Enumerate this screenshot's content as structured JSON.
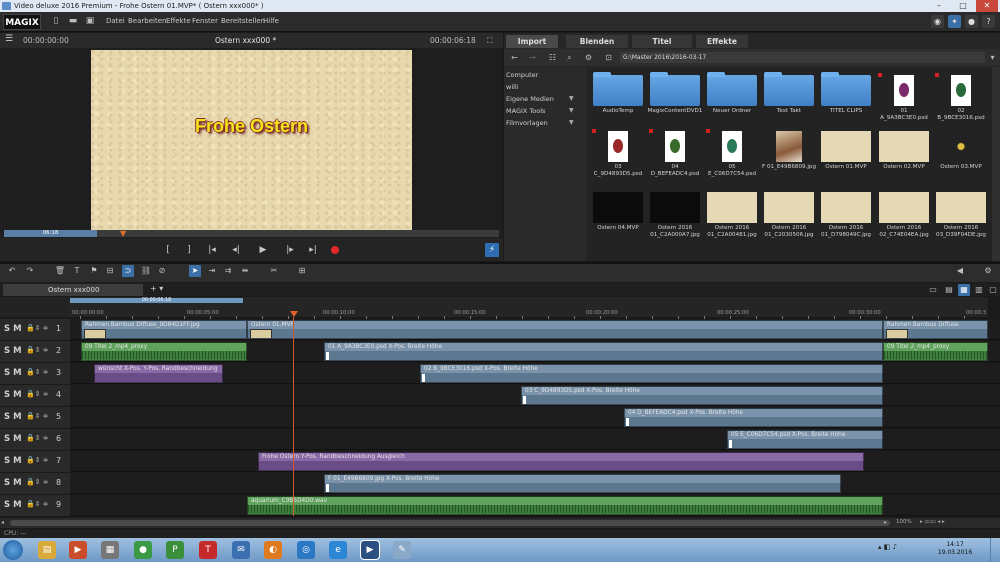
{
  "window": {
    "title": "Video deluxe 2016 Premium - Frohe Ostern 01.MVP* ( Ostern xxx000* )",
    "controls": [
      "–",
      "□",
      "✕"
    ]
  },
  "menubar": {
    "logo": "MAGIX",
    "items": [
      "Datei",
      "Bearbeiten",
      "Effekte",
      "Fenster",
      "Bereitstellen",
      "Hilfe"
    ]
  },
  "preview": {
    "timecode_left": "00:00:00:00",
    "title": "Ostern xxx000 *",
    "timecode_right": "00:00:06:18",
    "canvas_text": "Frohe Ostern",
    "scrub_label": "06:18"
  },
  "transport": {
    "in": "[",
    "out": "]",
    "prev_marker": "|◂",
    "prev": "◂|",
    "play": "▶",
    "next": "|▸",
    "next_marker": "▸|",
    "flash": "⚡"
  },
  "pool": {
    "tabs": [
      "Import",
      "Blenden",
      "Titel",
      "Effekte"
    ],
    "active_tab": "Import",
    "path": "G:\\Master 2016\\2016-03-17",
    "tree": [
      {
        "label": "Computer",
        "arrow": ""
      },
      {
        "label": "willi",
        "arrow": ""
      },
      {
        "label": "Eigene Medien",
        "arrow": "▼"
      },
      {
        "label": "MAGIX Tools",
        "arrow": "▼"
      },
      {
        "label": "Filmvorlagen",
        "arrow": "▼"
      }
    ],
    "items": [
      {
        "label": "AudioTemp",
        "kind": "folder"
      },
      {
        "label": "MagixContentDVD1",
        "kind": "folder"
      },
      {
        "label": "Neuer Ordner",
        "kind": "folder"
      },
      {
        "label": "Test Takt",
        "kind": "folder"
      },
      {
        "label": "TITEL CLIPS",
        "kind": "folder"
      },
      {
        "label": "01 A_9A3BC3E0.psd",
        "kind": "psd",
        "egg": "#7a2a6a"
      },
      {
        "label": "02 B_9BCE3016.psd",
        "kind": "psd",
        "egg": "#2a6a3a"
      },
      {
        "label": "03 C_9D4893D5.psd",
        "kind": "psd",
        "egg": "#9a2a2a"
      },
      {
        "label": "04 D_BEFEADC4.psd",
        "kind": "psd",
        "egg": "#3a6a2a"
      },
      {
        "label": "05 E_C06D7C54.psd",
        "kind": "psd",
        "egg": "#2a7a5a"
      },
      {
        "label": "F 01_E49B6809.jpg",
        "kind": "photo"
      },
      {
        "label": "Ostern 01.MVP",
        "kind": "mvp"
      },
      {
        "label": "Ostern 02.MVP",
        "kind": "mvp"
      },
      {
        "label": "Ostern 03.MVP",
        "kind": "dark"
      },
      {
        "label": "Ostern 04.MVP",
        "kind": "dark"
      },
      {
        "label": "Ostern 2016 01_C2A000A7.jpg",
        "kind": "dark"
      },
      {
        "label": "Ostern 2016 01_C2A00481.jpg",
        "kind": "mvp"
      },
      {
        "label": "Ostern 2016 01_C2030506.jpg",
        "kind": "mvp"
      },
      {
        "label": "Ostern 2016 01_D798049C.jpg",
        "kind": "mvp"
      },
      {
        "label": "Ostern 2016 02_C74E04EA.jpg",
        "kind": "mvp"
      },
      {
        "label": "Ostern 2016 03_D39F04DE.jpg",
        "kind": "mvp"
      }
    ]
  },
  "timeline": {
    "tab": "Ostern xxx000",
    "add_tab": "+ ▾",
    "range_label": "00:00:06:18",
    "ruler": [
      "00:00:00:00",
      "00:00:05:00",
      "00:00:10:00",
      "00:00:15:00",
      "00:00:20:00",
      "00:00:25:00",
      "00:00:30:00",
      "00:00:3"
    ],
    "track_numbers": [
      "1",
      "2",
      "3",
      "4",
      "5",
      "6",
      "7",
      "8",
      "9"
    ],
    "track_header": {
      "s": "S",
      "m": "M",
      "icons": "🔒⇕ ≑"
    },
    "objects": {
      "t1a": "Rahmen Bambus Diffuse_9D84D1FF.jpg",
      "t1b": "Ostern 01.MVP",
      "t1c": "Rahmen Bambus Diffuse",
      "t2a": "09 Titel 2_mp4_proxy",
      "t2b": "01 A_9A3BC3E0.psd  X-Pos.  Breite  Höhe",
      "t2c": "09 Titel 2_mp4_proxy",
      "t3a": "wünscht  X-Pos.  Y-Pos.  Randbeschneidung",
      "t3b": "02 B_9BCE3016.psd  X-Pos.  Breite  Höhe",
      "t4": "03 C_9D4893D5.psd  X-Pos.  Breite  Höhe",
      "t5": "04 D_BEFEADC4.psd  X-Pos.  Breite  Höhe",
      "t6": "05 E_C06D7C54.psd  X-Pos.  Breite  Höhe",
      "t7": "Frohe Ostern  Y-Pos.  Randbeschneidung Ausgleich",
      "t8": "F 01_E49B6809.jpg  X-Pos.  Breite  Höhe",
      "t9": "aquarium_C9B5D4D0.wav"
    },
    "zoom": "100%",
    "zoom_controls": "▸  ▫▫▫  ◂  ▸"
  },
  "status": {
    "cpu": "CPU: —"
  },
  "taskbar": {
    "time": "14:17",
    "date": "19.03.2016"
  },
  "colors": {
    "accent": "#3b6fa8",
    "video_object": "#5c7890",
    "audio_object": "#3f7f3d",
    "title_object": "#6a4d86",
    "playhead": "#d05a2a"
  }
}
